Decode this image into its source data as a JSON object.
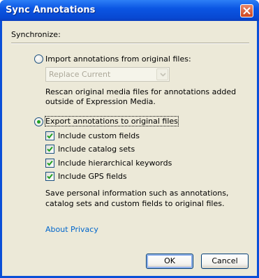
{
  "window": {
    "title": "Sync Annotations"
  },
  "group": {
    "label": "Synchronize:"
  },
  "import": {
    "radio_label": "Import annotations from original files:",
    "selected": false,
    "dropdown_value": "Replace Current",
    "description_line1": "Rescan original media files for annotations added",
    "description_line2": "outside of Expression Media."
  },
  "export": {
    "radio_label": "Export annotations to original files",
    "selected": true,
    "options": [
      {
        "label": "Include custom fields",
        "checked": true
      },
      {
        "label": "Include catalog sets",
        "checked": true
      },
      {
        "label": "Include hierarchical keywords",
        "checked": true
      },
      {
        "label": "Include GPS fields",
        "checked": true
      }
    ],
    "description_line1": "Save personal information such as annotations,",
    "description_line2": "catalog sets and custom fields to original files."
  },
  "privacy_link": "About Privacy",
  "buttons": {
    "ok": "OK",
    "cancel": "Cancel"
  }
}
